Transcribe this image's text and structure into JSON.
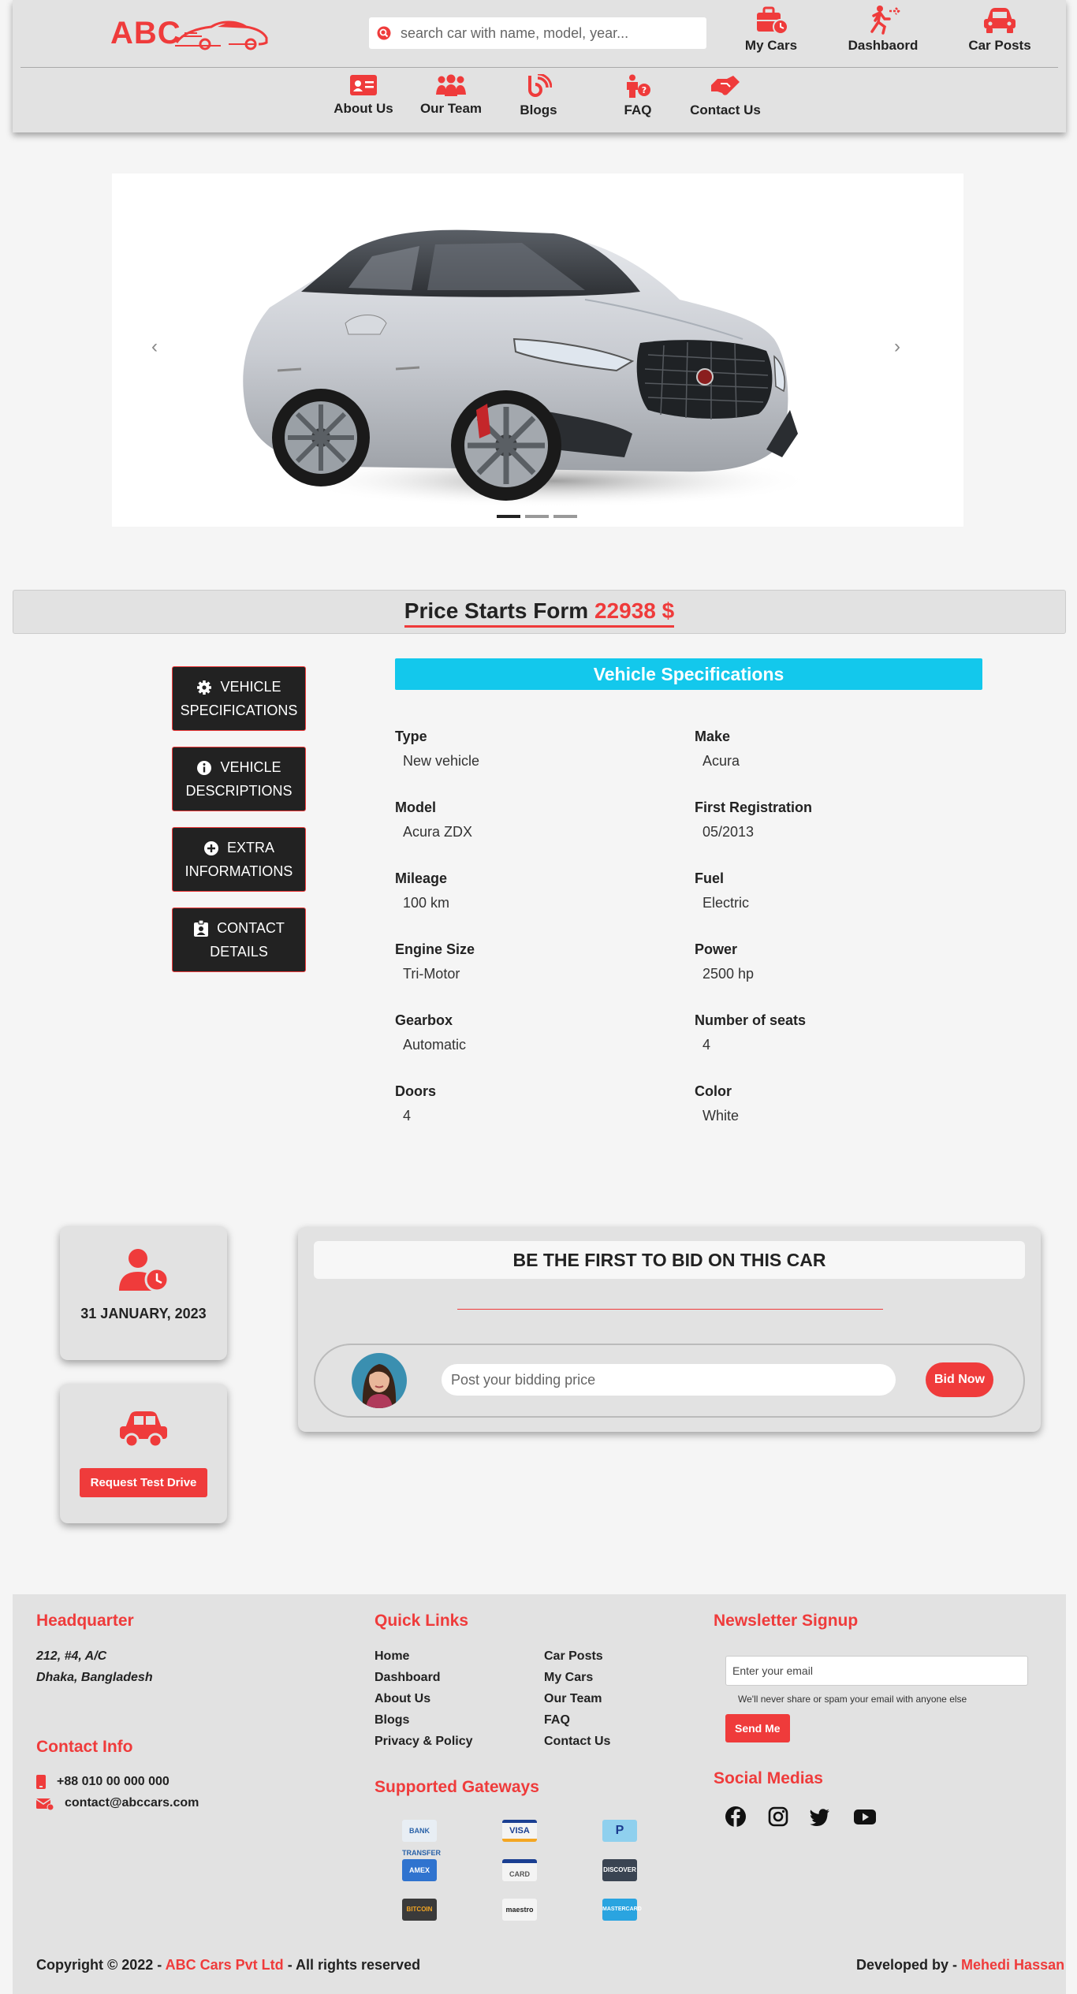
{
  "header": {
    "brand": "ABC",
    "search_placeholder": "search car with name, model, year...",
    "top_nav": [
      {
        "label": "My Cars",
        "icon": "briefcase-clock-icon"
      },
      {
        "label": "Dashbaord",
        "icon": "running-person-icon"
      },
      {
        "label": "Car Posts",
        "icon": "car-icon"
      }
    ],
    "sub_nav": [
      {
        "label": "About Us",
        "icon": "id-card-icon"
      },
      {
        "label": "Our Team",
        "icon": "users-icon"
      },
      {
        "label": "Blogs",
        "icon": "blog-icon"
      },
      {
        "label": "FAQ",
        "icon": "person-question-icon"
      },
      {
        "label": "Contact Us",
        "icon": "handshake-icon"
      }
    ]
  },
  "carousel": {
    "prev": "‹",
    "next": "›",
    "slide_count": 3,
    "active_slide": 0
  },
  "price": {
    "label": "Price Starts Form",
    "value": "22938 $"
  },
  "tabs": [
    {
      "label": "VEHICLE SPECIFICATIONS",
      "icon": "gear-icon"
    },
    {
      "label": "VEHICLE DESCRIPTIONS",
      "icon": "info-icon"
    },
    {
      "label": "EXTRA INFORMATIONS",
      "icon": "plus-circle-icon"
    },
    {
      "label": "CONTACT DETAILS",
      "icon": "contact-card-icon"
    }
  ],
  "specs": {
    "title": "Vehicle Specifications",
    "items": [
      {
        "label": "Type",
        "value": "New vehicle"
      },
      {
        "label": "Make",
        "value": "Acura"
      },
      {
        "label": "Model",
        "value": "Acura ZDX"
      },
      {
        "label": "First Registration",
        "value": "05/2013"
      },
      {
        "label": "Mileage",
        "value": "100 km"
      },
      {
        "label": "Fuel",
        "value": "Electric"
      },
      {
        "label": "Engine Size",
        "value": "Tri-Motor"
      },
      {
        "label": "Power",
        "value": "2500 hp"
      },
      {
        "label": "Gearbox",
        "value": "Automatic"
      },
      {
        "label": "Number of seats",
        "value": "4"
      },
      {
        "label": "Doors",
        "value": "4"
      },
      {
        "label": "Color",
        "value": "White"
      }
    ]
  },
  "post_card": {
    "date": "31 JANUARY, 2023"
  },
  "test_drive": {
    "button": "Request Test Drive"
  },
  "bid": {
    "title": "BE THE FIRST TO BID ON THIS CAR",
    "placeholder": "Post your bidding price",
    "button": "Bid Now"
  },
  "footer": {
    "hq_title": "Headquarter",
    "hq_line1": "212, #4, A/C",
    "hq_line2": "Dhaka, Bangladesh",
    "contact_title": "Contact Info",
    "phone": "+88 010 00 000 000",
    "email": "contact@abccars.com",
    "quick_title": "Quick Links",
    "quick_links": [
      "Home",
      "Car Posts",
      "Dashboard",
      "My Cars",
      "About Us",
      "Our Team",
      "Blogs",
      "FAQ",
      "Privacy & Policy",
      "Contact Us"
    ],
    "gateways_title": "Supported Gateways",
    "gateways": [
      "BANK TRANSFER",
      "VISA",
      "P",
      "AMEX",
      "CARD",
      "DISCOVER",
      "BITCOIN",
      "maestro",
      "MASTERCARD"
    ],
    "newsletter_title": "Newsletter Signup",
    "newsletter_placeholder": "Enter your email",
    "newsletter_note": "We'll never share or spam your email with anyone else",
    "newsletter_button": "Send Me",
    "social_title": "Social Medias",
    "copyright_prefix": "Copyright © 2022 -",
    "copyright_brand": "ABC Cars Pvt Ltd",
    "copyright_suffix": "- All rights reserved",
    "dev_prefix": "Developed by -",
    "dev_name": "Mehedi Hassan"
  },
  "colors": {
    "accent": "#ef3b3b",
    "spec_header": "#13c8ec",
    "tab_bg": "#222222"
  }
}
